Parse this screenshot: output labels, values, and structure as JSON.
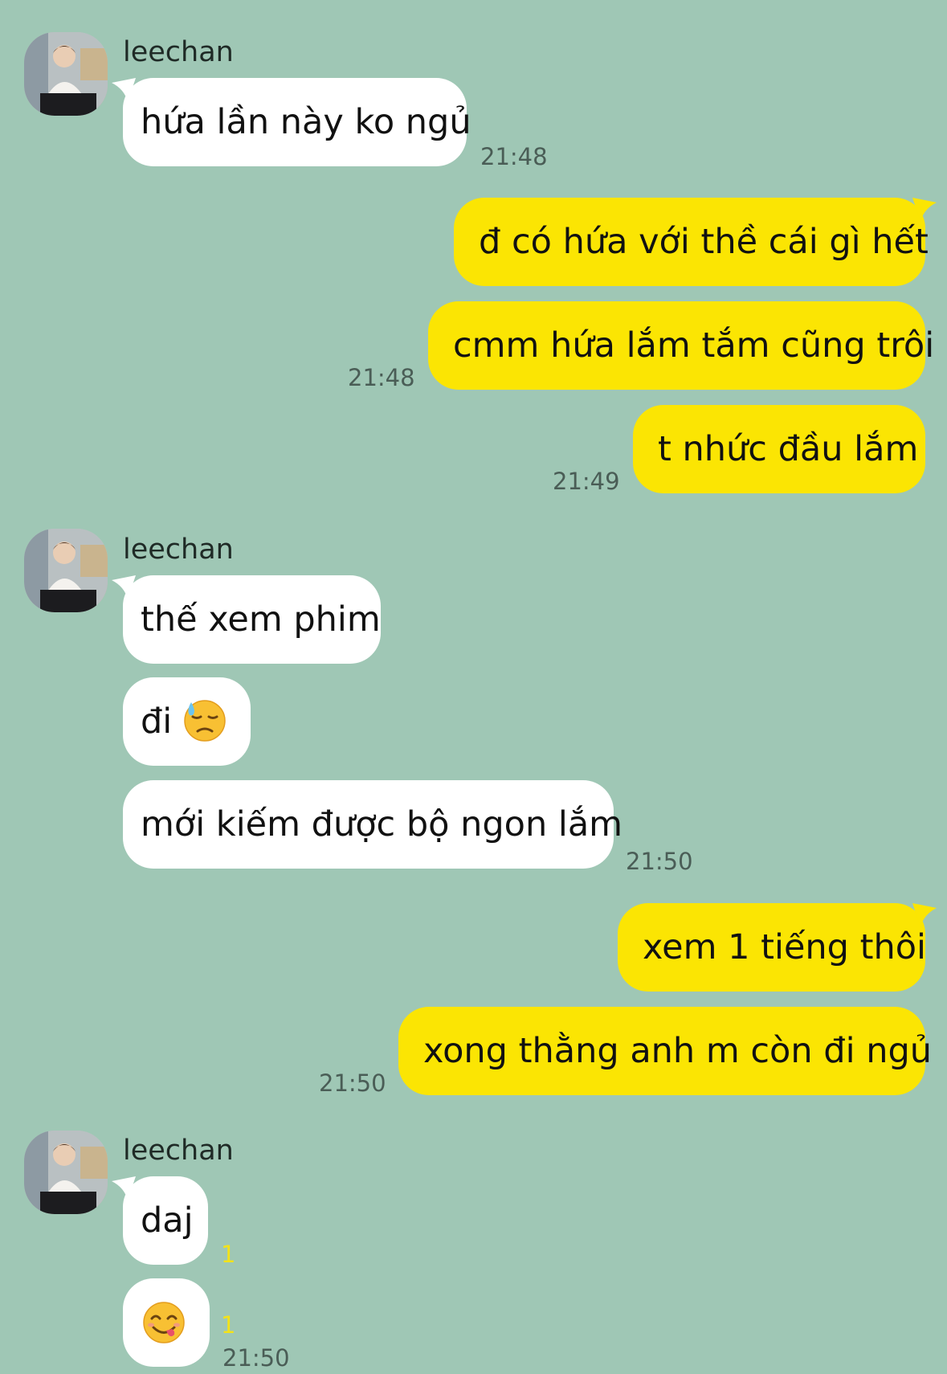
{
  "sender_name": "leechan",
  "messages": {
    "m1": "hứa lần này ko ngủ",
    "m2": "đ có hứa với thề cái gì hết",
    "m3": "cmm hứa lắm tắm cũng trôi",
    "m4": "t nhức đầu lắm",
    "m5": "thế xem phim",
    "m6": "đi",
    "m7": "mới kiếm được bộ ngon lắm",
    "m8": "xem 1 tiếng thôi",
    "m9": "xong thằng anh m còn đi ngủ",
    "m10": "daj"
  },
  "times": {
    "t1": "21:48",
    "t2": "21:48",
    "t3": "21:49",
    "t4": "21:50",
    "t5": "21:50",
    "t6": "21:50"
  },
  "unread": {
    "u1": "1",
    "u2": "1"
  },
  "icons": {
    "emoji_sweat": "downcast-face-with-sweat-emoji",
    "emoji_yum": "face-savoring-food-emoji"
  },
  "colors": {
    "background": "#9fc7b5",
    "incoming_bubble": "#ffffff",
    "outgoing_bubble": "#fbe503",
    "unread_count": "#f3e219"
  }
}
